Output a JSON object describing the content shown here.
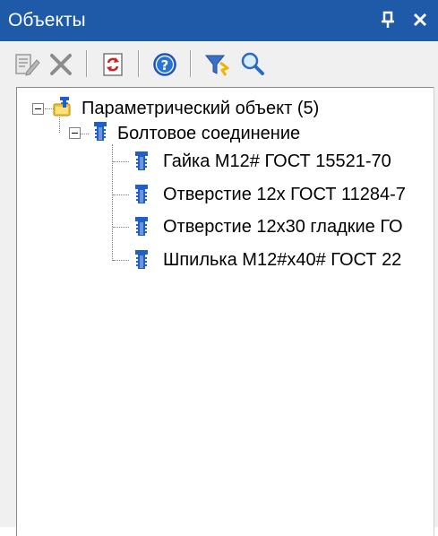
{
  "window": {
    "title": "Объекты",
    "pin_glyph": "ᛘ",
    "close_glyph": "✕"
  },
  "toolbar": {
    "buttons": [
      {
        "icon": "edit-properties-icon"
      },
      {
        "icon": "delete-icon"
      },
      {
        "icon": "refresh-icon"
      },
      {
        "icon": "help-icon"
      },
      {
        "icon": "filter-icon"
      },
      {
        "icon": "search-icon"
      }
    ]
  },
  "tree": {
    "root": {
      "label": "Параметрический объект (5)",
      "icon": "parametric-object-icon",
      "expanded": true
    },
    "group": {
      "label": "Болтовое соединение",
      "icon": "fastener-icon",
      "expanded": true
    },
    "items": [
      {
        "label": "Гайка М12# ГОСТ 15521-70",
        "icon": "fastener-icon"
      },
      {
        "label": "Отверстие 12х ГОСТ 11284-7",
        "icon": "fastener-icon"
      },
      {
        "label": "Отверстие 12х30 гладкие ГО",
        "icon": "fastener-icon"
      },
      {
        "label": "Шпилька М12#х40# ГОСТ 22",
        "icon": "fastener-icon"
      }
    ]
  },
  "colors": {
    "titlebar": "#1e5aa8",
    "panel": "#f0f0f0",
    "fastener_blue": "#1f5fc7",
    "folder_yellow": "#f2c335"
  }
}
